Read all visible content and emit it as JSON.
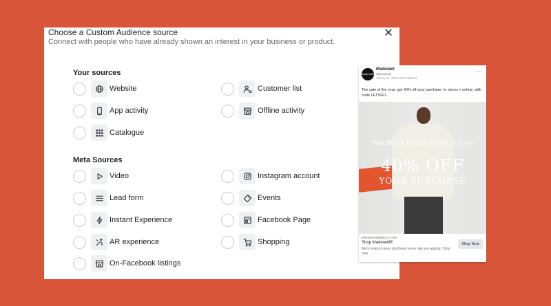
{
  "dialog": {
    "title": "Choose a Custom Audience source",
    "subtitle": "Connect with people who have already shown an interest in your business or product.",
    "close_icon": "close-icon"
  },
  "your_sources": {
    "title": "Your sources",
    "options": [
      {
        "label": "Website",
        "icon": "globe-icon"
      },
      {
        "label": "Customer list",
        "icon": "user-list-icon"
      },
      {
        "label": "App activity",
        "icon": "phone-icon"
      },
      {
        "label": "Offline activity",
        "icon": "store-icon"
      },
      {
        "label": "Catalogue",
        "icon": "grid-icon"
      }
    ]
  },
  "meta_sources": {
    "title": "Meta Sources",
    "options": [
      {
        "label": "Video",
        "icon": "play-icon"
      },
      {
        "label": "Instagram account",
        "icon": "instagram-icon"
      },
      {
        "label": "Lead form",
        "icon": "form-lines-icon"
      },
      {
        "label": "Events",
        "icon": "ticket-icon"
      },
      {
        "label": "Instant Experience",
        "icon": "lightning-icon"
      },
      {
        "label": "Facebook Page",
        "icon": "page-icon"
      },
      {
        "label": "AR experience",
        "icon": "sparkle-icon"
      },
      {
        "label": "Shopping",
        "icon": "cart-icon"
      },
      {
        "label": "On-Facebook listings",
        "icon": "shop-icon"
      }
    ]
  },
  "ad": {
    "logo_text": "Madewell",
    "brand": "Madewell",
    "sponsored": "Sponsored",
    "library_id": "Library ID: 359977937490219",
    "more": "···",
    "text": "The sale of the year: get 40% off your purchase. In stores + online, with code LETSGO.",
    "image": {
      "line1": "The Black Friday Event is here",
      "line2": "40% OFF",
      "line3": "YOUR PURCHASE"
    },
    "url": "WWW.MADEWELL.COM",
    "shop_title": "Shop Madewell®",
    "description": "More looks to wear (and love) every day are waiting. Shop now.",
    "cta": "Shop Now"
  }
}
